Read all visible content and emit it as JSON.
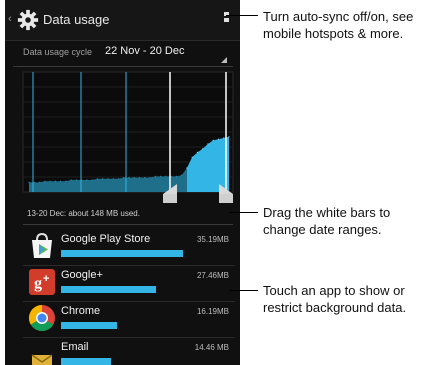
{
  "actionbar": {
    "title": "Data usage"
  },
  "cycle": {
    "label": "Data usage cycle",
    "value": "22 Nov - 20 Dec"
  },
  "usage": {
    "summary": "13-20 Dec: about 148 MB used.",
    "series": [
      0.08,
      0.08,
      0.08,
      0.09,
      0.09,
      0.09,
      0.09,
      0.09,
      0.1,
      0.1,
      0.1,
      0.1,
      0.1,
      0.11,
      0.11,
      0.11,
      0.11,
      0.11,
      0.12,
      0.12,
      0.12,
      0.12,
      0.12,
      0.12,
      0.13,
      0.13,
      0.13,
      0.13,
      0.13,
      0.14,
      0.2,
      0.29,
      0.33,
      0.36,
      0.4,
      0.43,
      0.44,
      0.45,
      0.46
    ],
    "selected_start_index": 30
  },
  "apps": [
    {
      "name": "Google Play Store",
      "size": "35.19MB",
      "level": 1.0
    },
    {
      "name": "Google+",
      "size": "27.46MB",
      "level": 0.78
    },
    {
      "name": "Chrome",
      "size": "16.19MB",
      "level": 0.46
    },
    {
      "name": "Email",
      "size": "14.46 MB",
      "level": 0.41
    }
  ],
  "callouts": {
    "sync": "Turn auto-sync off/on, see mobile hotspots & more.",
    "drag": "Drag the white bars to change date ranges.",
    "touch": "Touch an app to show or restrict background data."
  }
}
